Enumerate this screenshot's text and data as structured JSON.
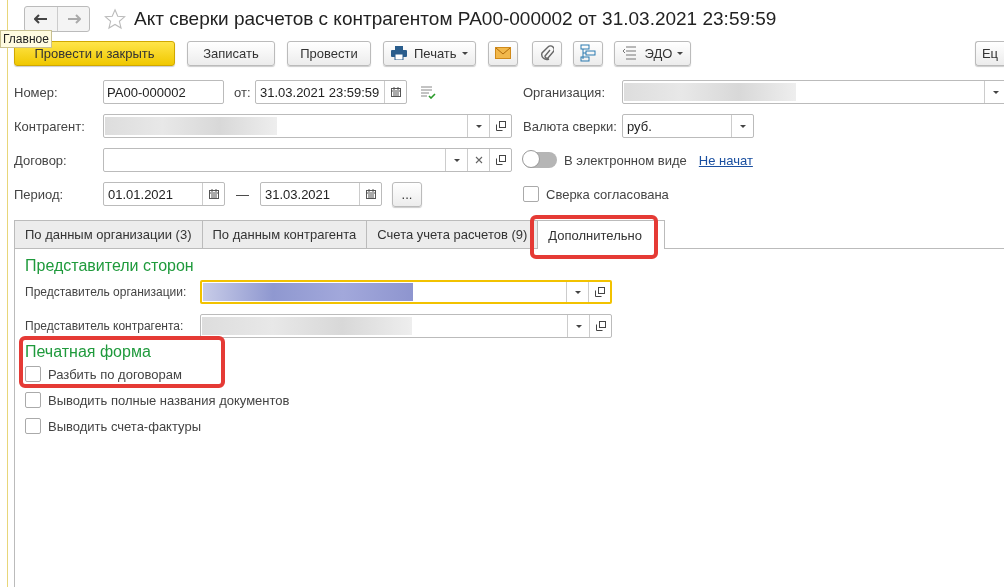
{
  "window": {
    "title": "Акт сверки расчетов с контрагентом РА00-000002 от 31.03.2021 23:59:59",
    "favorite": false
  },
  "tooltip": "Главное",
  "toolbar": [
    {
      "kind": "primary",
      "label": "Провести и закрыть"
    },
    {
      "kind": "plain",
      "label": "Записать"
    },
    {
      "kind": "plain",
      "label": "Провести"
    },
    {
      "kind": "print",
      "label": "Печать"
    },
    {
      "kind": "mail"
    },
    {
      "kind": "clip"
    },
    {
      "kind": "struct"
    },
    {
      "kind": "edo",
      "label": "ЭДО"
    },
    {
      "kind": "more",
      "label": "Ец"
    }
  ],
  "number": {
    "label": "Номер:",
    "value": "РА00-000002",
    "date_label": "от:",
    "date": "31.03.2021 23:59:59"
  },
  "organization": {
    "label": "Организация:",
    "redacted": true
  },
  "counterparty": {
    "label": "Контрагент:",
    "redacted": true
  },
  "currency": {
    "label": "Валюта сверки:",
    "value": "руб."
  },
  "contract": {
    "label": "Договор:"
  },
  "electronic": {
    "on": false,
    "label": "В электронном виде",
    "status": "Не начат"
  },
  "period": {
    "label": "Период:",
    "from": "01.01.2021",
    "dash": "—",
    "to": "31.03.2021",
    "more": "..."
  },
  "agreed": {
    "label": "Сверка согласована",
    "checked": false
  },
  "tabs": [
    {
      "label": "По данным организации (3)",
      "selected": false
    },
    {
      "label": "По данным контрагента",
      "selected": false
    },
    {
      "label": "Счета учета расчетов (9)",
      "selected": false
    },
    {
      "label": "Дополнительно",
      "selected": true
    }
  ],
  "representatives": {
    "title": "Представители сторон",
    "fields": [
      {
        "label": "Представитель организации:",
        "redacted": true,
        "focused": true
      },
      {
        "label": "Представитель контрагента:",
        "redacted": true,
        "focused": false
      }
    ]
  },
  "print_form": {
    "title": "Печатная форма",
    "options": [
      {
        "label": "Разбить по договорам",
        "checked": false
      },
      {
        "label": "Выводить полные названия документов",
        "checked": false
      },
      {
        "label": "Выводить счета-фактуры",
        "checked": false
      }
    ]
  }
}
